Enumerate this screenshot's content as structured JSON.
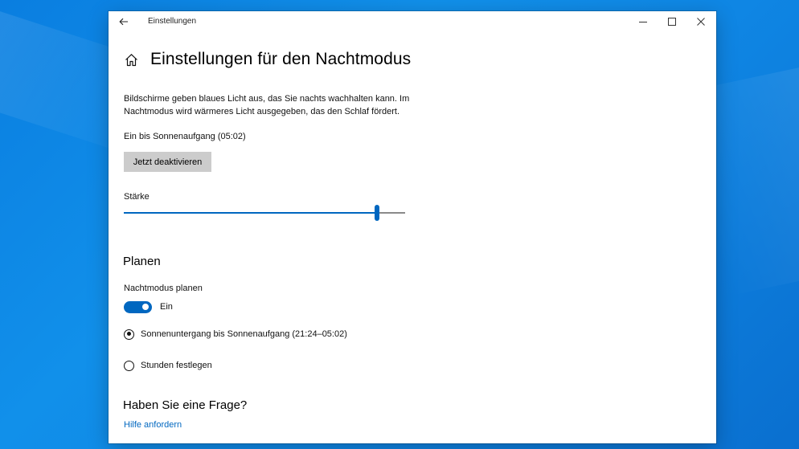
{
  "window": {
    "title": "Einstellungen"
  },
  "colors": {
    "accent": "#0067c0",
    "button_bg": "#cccccc",
    "desktop": "#0f86e4"
  },
  "page": {
    "title": "Einstellungen für den Nachtmodus",
    "description": "Bildschirme geben blaues Licht aus, das Sie nachts wachhalten kann. Im Nachtmodus wird wärmeres Licht ausgegeben, das den Schlaf fördert.",
    "status": "Ein bis Sonnenaufgang (05:02)",
    "deactivate_button": "Jetzt deaktivieren",
    "strength": {
      "label": "Stärke",
      "value_fraction": 0.9
    }
  },
  "schedule": {
    "heading": "Planen",
    "label": "Nachtmodus planen",
    "toggle_state": "Ein",
    "toggle_on": true,
    "options": [
      {
        "label": "Sonnenuntergang bis Sonnenaufgang (21:24–05:02)",
        "selected": true
      },
      {
        "label": "Stunden festlegen",
        "selected": false
      }
    ]
  },
  "help": {
    "heading": "Haben Sie eine Frage?",
    "link": "Hilfe anfordern"
  }
}
